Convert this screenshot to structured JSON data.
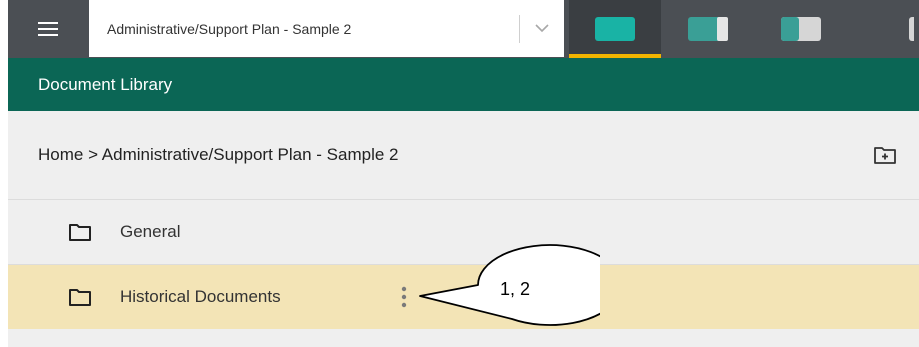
{
  "topbar": {
    "menu_icon": "hamburger-icon",
    "plan_select": {
      "value": "Administrative/Support Plan - Sample 2",
      "chevron_icon": "chevron-down-icon"
    },
    "layout_buttons": [
      {
        "icon": "layout-full-icon",
        "active": true
      },
      {
        "icon": "layout-split-right-icon",
        "active": false
      },
      {
        "icon": "layout-split-left-icon",
        "active": false
      },
      {
        "icon": "layout-partial-icon",
        "active": false
      }
    ],
    "accent_color": "#f2b400",
    "teal_color": "#19b3a5"
  },
  "library": {
    "title": "Document Library",
    "header_color": "#0b6655"
  },
  "breadcrumb": {
    "text": "Home > Administrative/Support Plan - Sample 2",
    "new_folder_icon": "folder-plus-icon"
  },
  "folders": [
    {
      "label": "General",
      "icon": "folder-icon",
      "selected": false
    },
    {
      "label": "Historical Documents",
      "icon": "folder-icon",
      "selected": true,
      "menu_icon": "more-vertical-icon"
    }
  ],
  "callout": {
    "text": "1, 2"
  },
  "colors": {
    "selected_row": "#f3e4b6",
    "row_bg": "#efefef"
  }
}
